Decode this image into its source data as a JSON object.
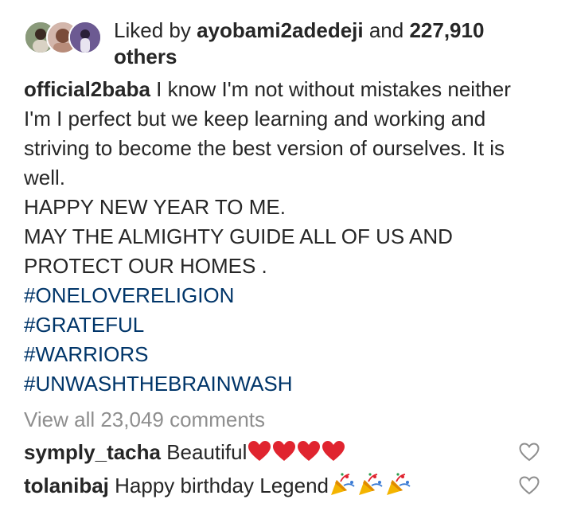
{
  "likes": {
    "prefix": "Liked by ",
    "user": "ayobami2adedeji",
    "middle": " and ",
    "count": "227,910",
    "suffix": "others"
  },
  "caption": {
    "username": "official2baba",
    "lines": [
      " I know I'm not without mistakes neither",
      "I'm I perfect but we keep learning and working and",
      "striving to become the best version  of ourselves. It is",
      "well.",
      "HAPPY NEW YEAR TO ME.",
      "MAY THE ALMIGHTY GUIDE ALL OF US AND",
      "PROTECT OUR HOMES ."
    ],
    "hashtags": [
      "#ONELOVERELIGION",
      "#GRATEFUL",
      "#WARRIORS",
      "#UNWASHTHEBRAINWASH"
    ]
  },
  "view_all_comments": "View all 23,049 comments",
  "comments": [
    {
      "username": "symply_tacha",
      "text": " Beautiful",
      "emoji": "red-heart",
      "emoji_count": 4
    },
    {
      "username": "tolanibaj",
      "text": " Happy birthday Legend",
      "emoji": "party-popper",
      "emoji_count": 3
    }
  ],
  "colors": {
    "text": "#262626",
    "hashtag": "#003569",
    "muted": "#8e8e8e",
    "heart": "#e0242f"
  },
  "icons": [
    "avatar-stack",
    "red-heart-emoji",
    "party-popper-emoji",
    "like-heart-outline-icon"
  ]
}
